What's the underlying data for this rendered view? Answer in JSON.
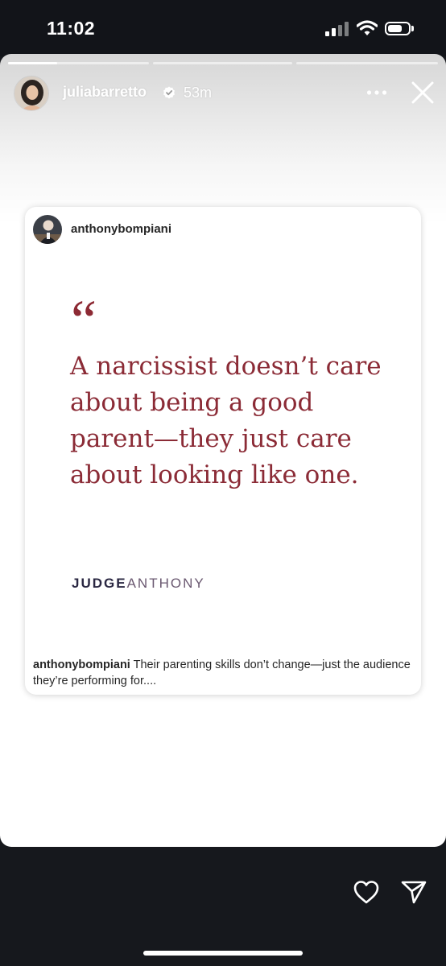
{
  "status_bar": {
    "time": "11:02",
    "signal_icon": "cellular-signal-icon",
    "wifi_icon": "wifi-icon",
    "battery_icon": "battery-icon",
    "battery_level": 0.7
  },
  "story": {
    "progress_segments": 3,
    "active_segment": 1,
    "active_progress": 0.35,
    "username": "juliabarretto",
    "verified": true,
    "time_ago": "53m",
    "more_icon": "more-horizontal-icon",
    "close_icon": "close-icon"
  },
  "post": {
    "author": "anthonybompiani",
    "quote_mark": "“",
    "quote_text": "A narcissist doesn’t care about being a good parent—they just care about looking like one.",
    "brand_bold": "JUDGE",
    "brand_light": "ANTHONY",
    "caption_author": "anthonybompiani",
    "caption_text": " Their parenting skills don’t change—just the audience they’re performing for....",
    "quote_color": "#8b2b36"
  },
  "actions": {
    "like_icon": "heart-icon",
    "share_icon": "send-icon"
  }
}
